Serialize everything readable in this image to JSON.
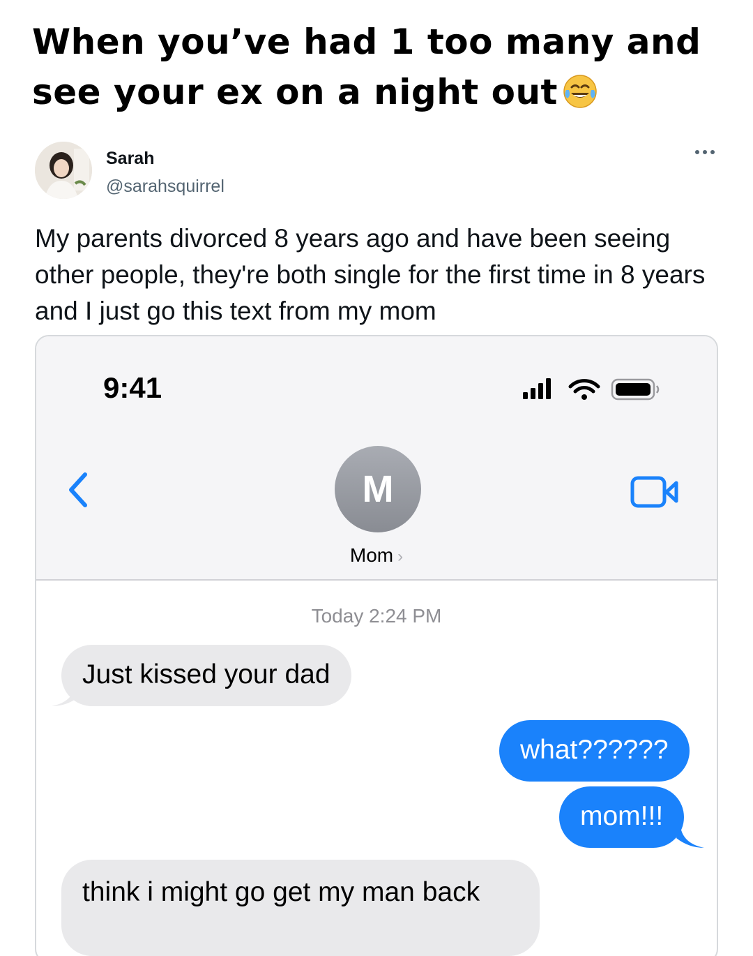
{
  "caption": {
    "text": "When you’ve had 1 too many and see your ex on a night out",
    "emoji": "face-with-tears-of-joy-icon"
  },
  "tweet": {
    "author_name": "Sarah",
    "author_handle": "@sarahsquirrel",
    "body": "My parents divorced 8 years ago and have been seeing other people, they're both single for the first time in 8 years and I just go this text from my mom"
  },
  "phone": {
    "status_time": "9:41",
    "contact_initial": "M",
    "contact_name": "Mom",
    "timestamp": "Today 2:24 PM",
    "messages": [
      {
        "from": "received",
        "text": "Just kissed your dad"
      },
      {
        "from": "sent",
        "text": "what??????"
      },
      {
        "from": "sent",
        "text": "mom!!!"
      },
      {
        "from": "received",
        "text": "think i might go get my man back"
      }
    ]
  },
  "colors": {
    "imessage_blue": "#1a82fb",
    "received_bubble": "#e9e9eb",
    "ios_link_blue": "#1a82fb",
    "handle_gray": "#536471"
  }
}
